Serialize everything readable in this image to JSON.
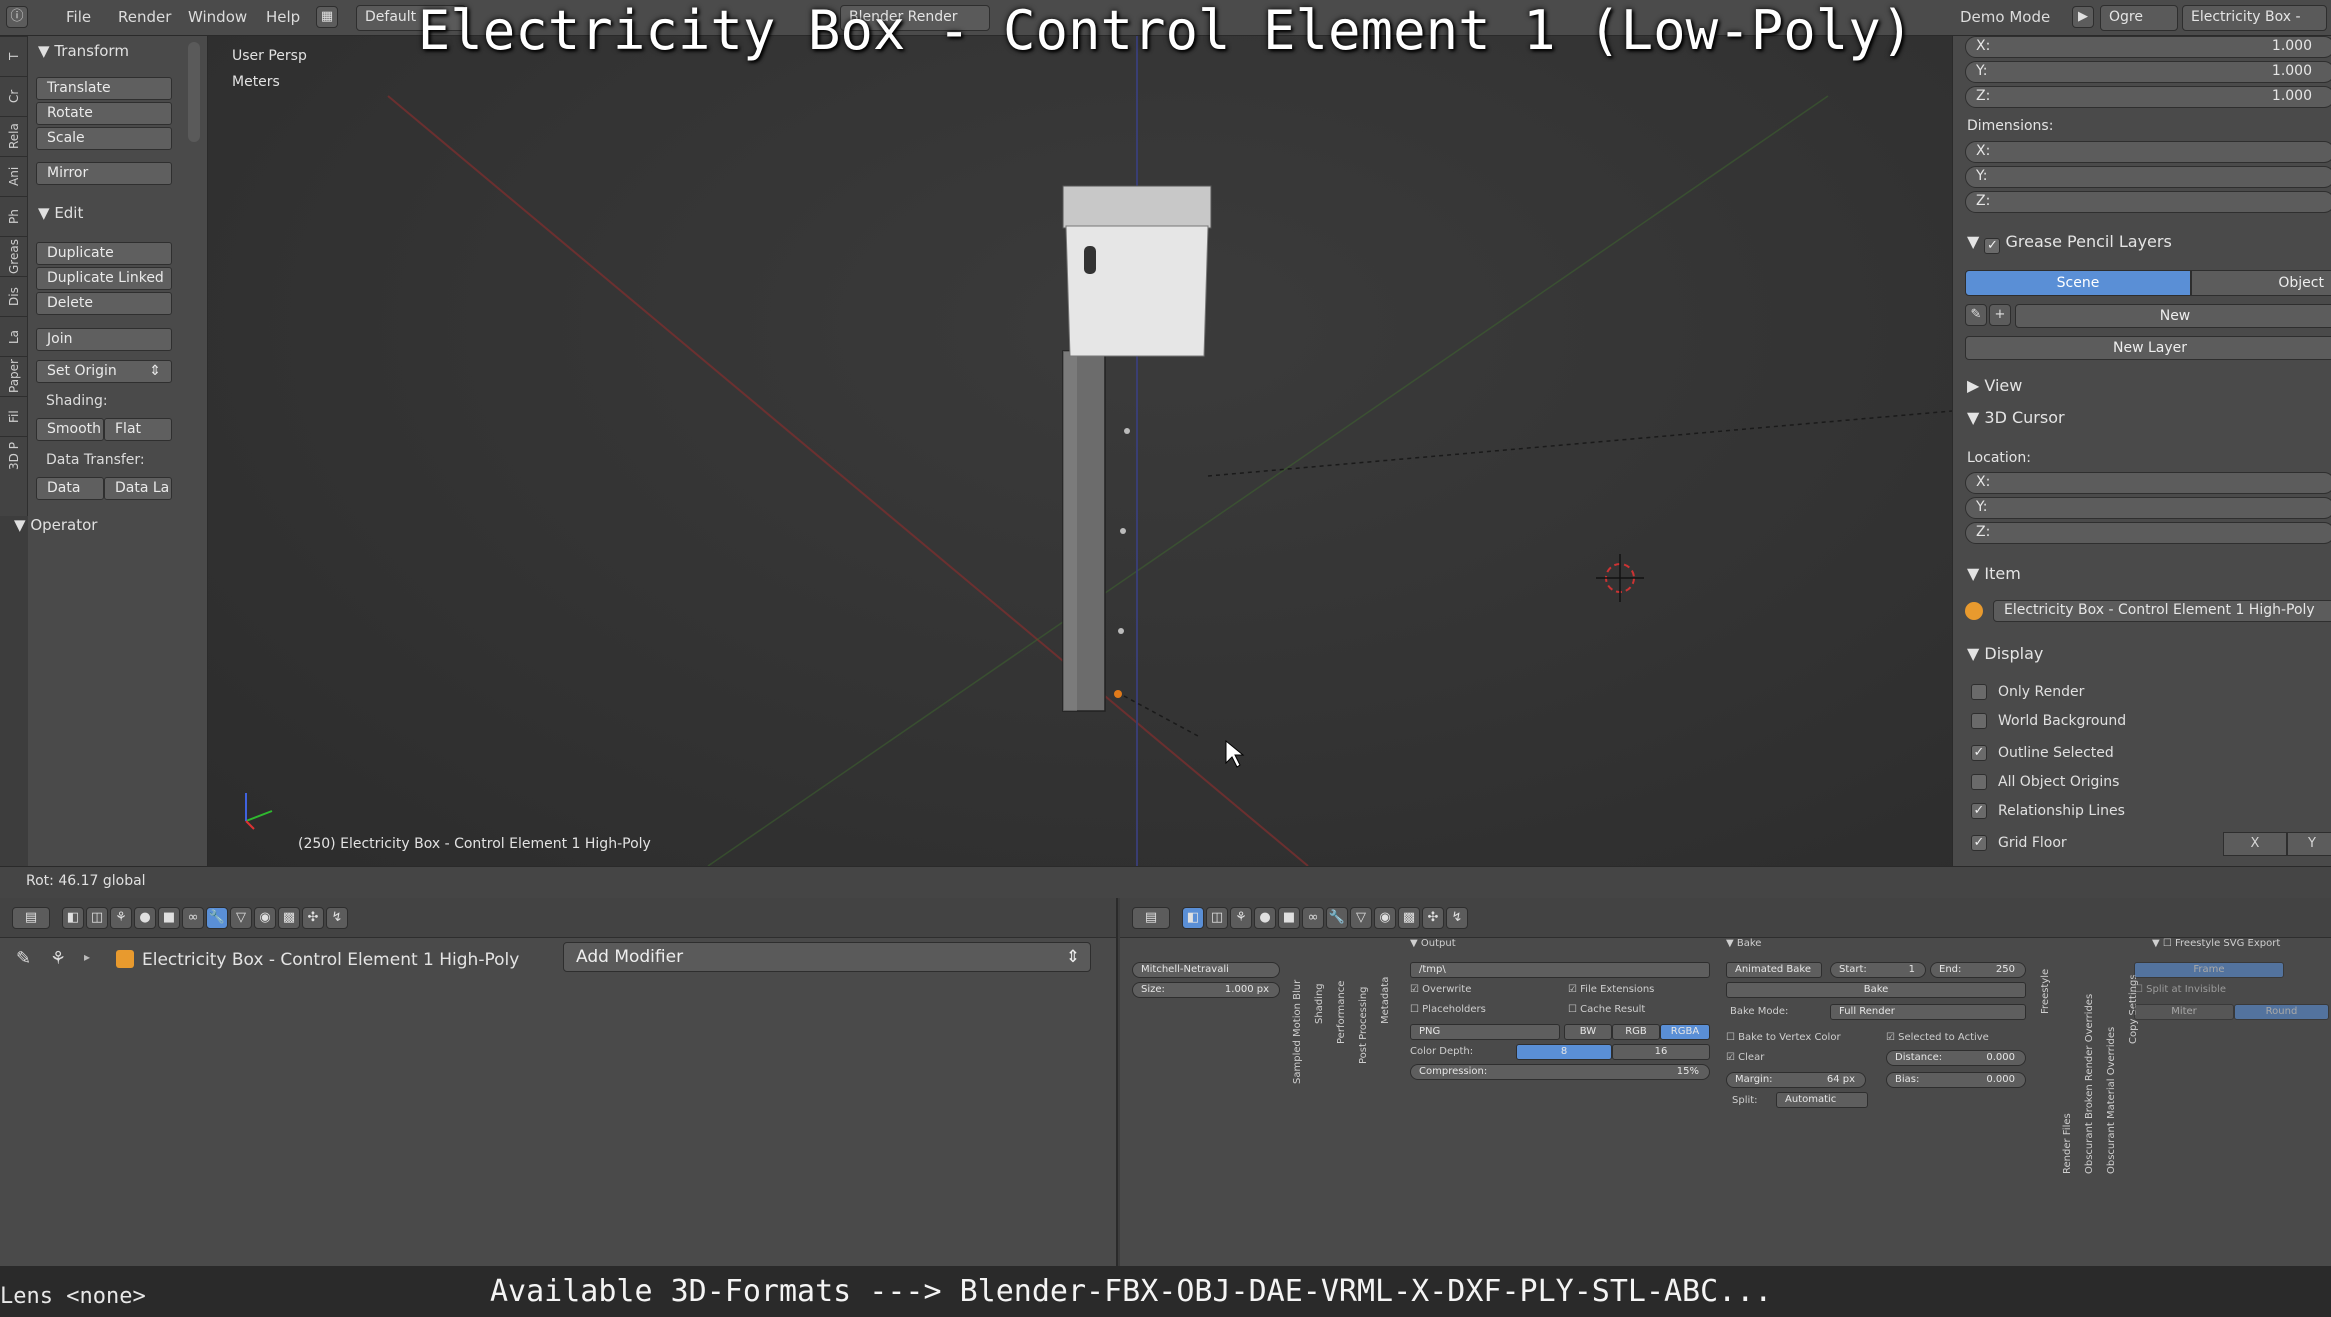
{
  "video_title": "Electricity Box - Control Element 1 (Low-Poly)",
  "footer_text": "Available 3D-Formats ---> Blender-FBX-OBJ-DAE-VRML-X-DXF-PLY-STL-ABC...",
  "lens_text": "Lens <none>",
  "topbar": {
    "menus": [
      "File",
      "Render",
      "Window",
      "Help"
    ],
    "layout": "Default",
    "engine": "Blender Render",
    "demo_mode": "Demo Mode",
    "ogre": "Ogre",
    "scene_field": "Electricity Box -"
  },
  "left_tabs": [
    "T",
    "Cr",
    "Rela",
    "Ani",
    "Ph",
    "Greas",
    "Dis",
    "La",
    "Paper",
    "Fil",
    "3D P"
  ],
  "tool_shelf": {
    "transform_header": "Transform",
    "translate": "Translate",
    "rotate": "Rotate",
    "scale": "Scale",
    "mirror": "Mirror",
    "edit_header": "Edit",
    "duplicate": "Duplicate",
    "duplicate_linked": "Duplicate Linked",
    "delete": "Delete",
    "join": "Join",
    "set_origin": "Set Origin",
    "shading_label": "Shading:",
    "smooth": "Smooth",
    "flat": "Flat",
    "data_transfer_label": "Data Transfer:",
    "data": "Data",
    "data_la": "Data La",
    "operator_header": "Operator"
  },
  "viewport": {
    "view_name": "User Persp",
    "units": "Meters",
    "object_info": "(250) Electricity Box - Control Element 1 High-Poly"
  },
  "properties": {
    "scale_x_label": "X:",
    "scale_x": "1.000",
    "scale_y_label": "Y:",
    "scale_y": "1.000",
    "scale_z_label": "Z:",
    "scale_z": "1.000",
    "dimensions_label": "Dimensions:",
    "dim_x": "X:",
    "dim_y": "Y:",
    "dim_z": "Z:",
    "grease_pencil_layers": "Grease Pencil Layers",
    "scene_tab": "Scene",
    "object_tab": "Object",
    "new_btn": "New",
    "new_layer_btn": "New Layer",
    "view_header": "View",
    "cursor_header": "3D Cursor",
    "location_label": "Location:",
    "loc_x": "X:",
    "loc_y": "Y:",
    "loc_z": "Z:",
    "item_header": "Item",
    "item_name": "Electricity Box - Control Element 1 High-Poly",
    "display_header": "Display",
    "only_render": "Only Render",
    "world_background": "World Background",
    "outline_selected": "Outline Selected",
    "all_object_origins": "All Object Origins",
    "relationship_lines": "Relationship Lines",
    "grid_floor": "Grid Floor",
    "grid_x": "X",
    "grid_y": "Y"
  },
  "status": {
    "rot": "Rot: 46.17 global"
  },
  "modifier_panel": {
    "object_name": "Electricity Box - Control Element 1 High-Poly",
    "add_modifier": "Add Modifier"
  },
  "render_panel": {
    "filter": "Mitchell-Netravali",
    "size_label": "Size:",
    "size_value": "1.000 px",
    "vertical_tabs": [
      "Sampled Motion Blur",
      "Shading",
      "Performance",
      "Post Processing",
      "Metadata"
    ],
    "output_header": "Output",
    "output_path": "/tmp\\",
    "overwrite": "Overwrite",
    "file_extensions": "File Extensions",
    "placeholders": "Placeholders",
    "cache_result": "Cache Result",
    "format": "PNG",
    "bw": "BW",
    "rgb": "RGB",
    "rgba": "RGBA",
    "color_depth_label": "Color Depth:",
    "depth_8": "8",
    "depth_16": "16",
    "compression_label": "Compression:",
    "compression_value": "15%",
    "bake_header": "Bake",
    "animated_bake": "Animated Bake",
    "start_label": "Start:",
    "start_value": "1",
    "end_label": "End:",
    "end_value": "250",
    "bake_btn": "Bake",
    "bake_mode_label": "Bake Mode:",
    "bake_mode": "Full Render",
    "bake_to_vertex": "Bake to Vertex Color",
    "selected_to_active": "Selected to Active",
    "clear": "Clear",
    "distance_label": "Distance:",
    "distance_value": "0.000",
    "margin_label": "Margin:",
    "margin_value": "64 px",
    "bias_label": "Bias:",
    "bias_value": "0.000",
    "split_label": "Split:",
    "split_value": "Automatic",
    "right_vertical_tabs": [
      "Freestyle",
      "Render Files",
      "Obscurant Broken Render Overrides",
      "Obscurant Material Overrides",
      "Copy Settings"
    ],
    "freestyle_svg": "Freestyle SVG Export",
    "frame": "Frame",
    "split_invisible": "Split at Invisible",
    "miter": "Miter",
    "round": "Round"
  }
}
